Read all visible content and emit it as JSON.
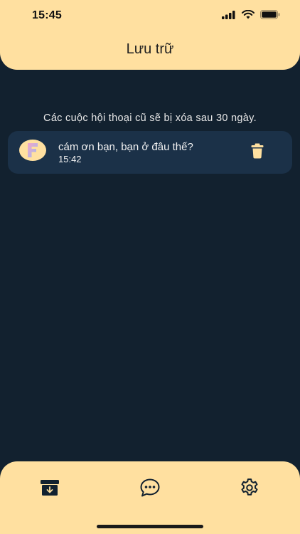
{
  "status_bar": {
    "time": "15:45"
  },
  "header": {
    "title": "Lưu trữ"
  },
  "notice": "Các cuộc hội thoại cũ sẽ bị xóa sau 30 ngày.",
  "conversations": [
    {
      "avatar_letter": "F",
      "message": "cám ơn bạn, bạn ở đâu thế?",
      "time": "15:42"
    }
  ],
  "tabbar": {
    "tabs": [
      {
        "icon": "archive-icon",
        "active": true
      },
      {
        "icon": "chat-bubble-icon",
        "active": false
      },
      {
        "icon": "gear-icon",
        "active": false
      }
    ]
  },
  "colors": {
    "background": "#12212f",
    "accent": "#ffe0a0",
    "card": "#1b3148",
    "text_light": "#f2f2f2",
    "text_dark": "#1f1f1f"
  }
}
